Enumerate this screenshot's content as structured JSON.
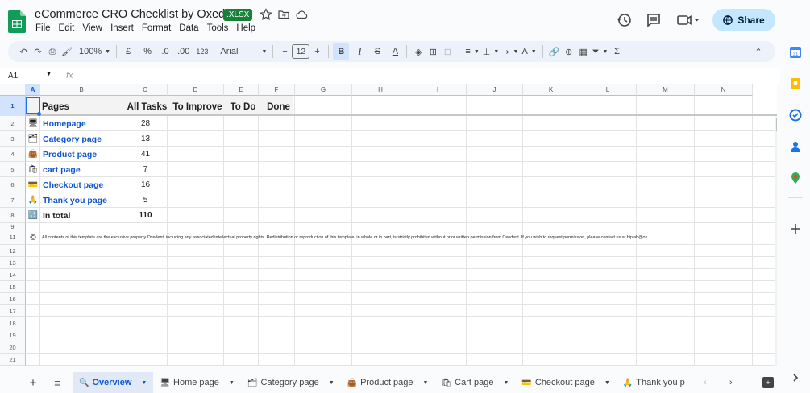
{
  "doc": {
    "title": "eCommerce CRO Checklist by Oxedent",
    "badge": ".XLSX"
  },
  "menu": [
    "File",
    "Edit",
    "View",
    "Insert",
    "Format",
    "Data",
    "Tools",
    "Help"
  ],
  "share_label": "Share",
  "toolbar": {
    "zoom": "100%",
    "currency": "£",
    "percent": "%",
    "dec_dec": ".0",
    "inc_dec": ".00",
    "fmt123": "123",
    "font": "Arial",
    "font_size": "12"
  },
  "formula": {
    "namebox": "A1",
    "fx": "fx"
  },
  "columns": [
    "A",
    "B",
    "C",
    "D",
    "E",
    "F",
    "G",
    "H",
    "I",
    "J",
    "K",
    "L",
    "M",
    "N"
  ],
  "rows": [
    "1",
    "2",
    "3",
    "4",
    "5",
    "6",
    "7",
    "8",
    "9",
    "11",
    "12",
    "13",
    "14",
    "15",
    "16",
    "17",
    "18",
    "19",
    "20",
    "21"
  ],
  "headers": {
    "pages": "Pages",
    "all_tasks": "All Tasks",
    "to_improve": "To Improve",
    "to_do": "To Do",
    "done": "Done"
  },
  "pages": [
    {
      "icon": "🖥",
      "name": "Homepage",
      "tasks": "28"
    },
    {
      "icon": "🗂",
      "name": "Category page",
      "tasks": "13"
    },
    {
      "icon": "👜",
      "name": "Product page",
      "tasks": "41"
    },
    {
      "icon": "🛍",
      "name": "cart page",
      "tasks": "7"
    },
    {
      "icon": "💳",
      "name": "Checkout page",
      "tasks": "16"
    },
    {
      "icon": "🙏",
      "name": "Thank you page",
      "tasks": "5"
    }
  ],
  "total": {
    "icon": "🔢",
    "label": "In total",
    "value": "110"
  },
  "copyright": {
    "icon": "©",
    "text": "All contents of this template are the exclusive property Oxedent, including any associated intellectual property rights. Redistribution or reproduction of this template, in whole or in part, is strictly prohibited without prior written permission from Oxedent. If you wish to request permission, please contact us at biplab@ox"
  },
  "sheets": [
    {
      "icon": "🔍",
      "label": "Overview"
    },
    {
      "icon": "🖥",
      "label": "Home page"
    },
    {
      "icon": "🗂",
      "label": "Category page"
    },
    {
      "icon": "👜",
      "label": "Product page"
    },
    {
      "icon": "🛍",
      "label": "Cart page"
    },
    {
      "icon": "💳",
      "label": "Checkout page"
    },
    {
      "icon": "🙏",
      "label": "Thank you p"
    }
  ],
  "colors": {
    "accent": "#0b57d0",
    "link": "#1155cc",
    "badge": "#188038",
    "share": "#c2e7ff"
  }
}
